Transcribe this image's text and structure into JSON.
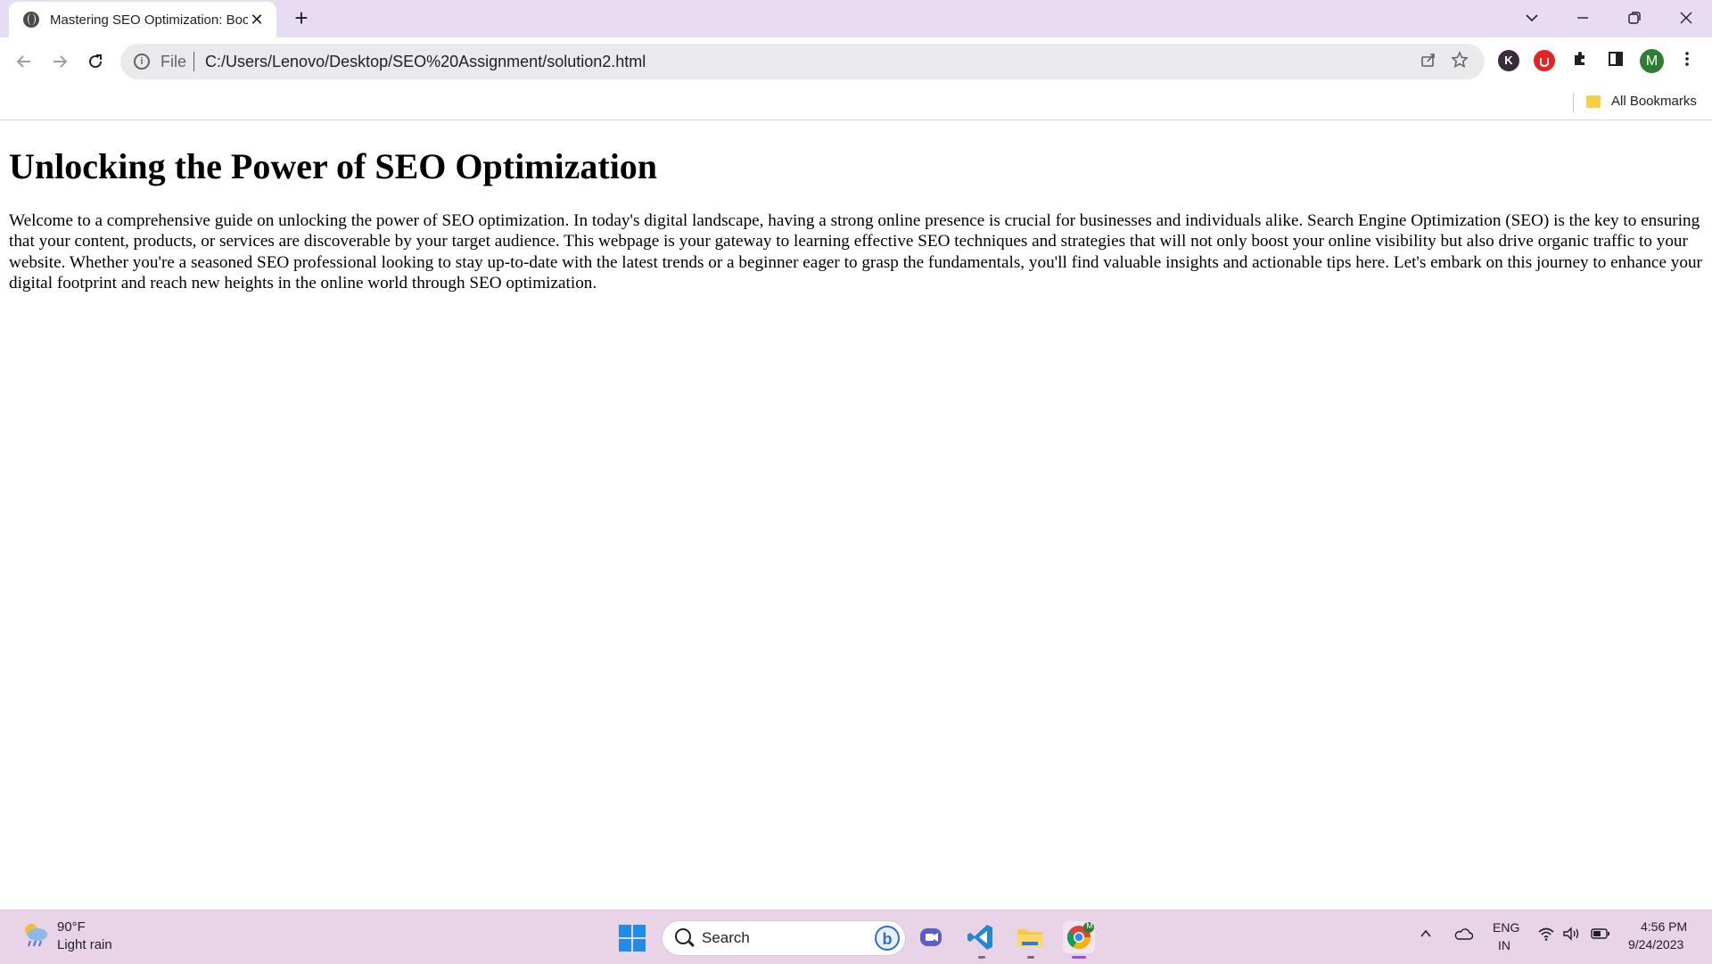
{
  "browser": {
    "tab_title": "Mastering SEO Optimization: Boo",
    "new_tab_glyph": "+",
    "tab_close_glyph": "✕",
    "omnibox": {
      "scheme": "File",
      "url": "C:/Users/Lenovo/Desktop/SEO%20Assignment/solution2.html"
    },
    "profile_initial": "M",
    "extension_k": "K",
    "bookmarks_label": "All Bookmarks"
  },
  "page": {
    "heading": "Unlocking the Power of SEO Optimization",
    "paragraph": "Welcome to a comprehensive guide on unlocking the power of SEO optimization. In today's digital landscape, having a strong online presence is crucial for businesses and individuals alike. Search Engine Optimization (SEO) is the key to ensuring that your content, products, or services are discoverable by your target audience. This webpage is your gateway to learning effective SEO techniques and strategies that will not only boost your online visibility but also drive organic traffic to your website. Whether you're a seasoned SEO professional looking to stay up-to-date with the latest trends or a beginner eager to grasp the fundamentals, you'll find valuable insights and actionable tips here. Let's embark on this journey to enhance your digital footprint and reach new heights in the online world through SEO optimization."
  },
  "taskbar": {
    "weather_temp": "90°F",
    "weather_condition": "Light rain",
    "search_placeholder": "Search",
    "language_line1": "ENG",
    "language_line2": "IN",
    "time": "4:56 PM",
    "date": "9/24/2023",
    "chrome_badge": "M"
  },
  "colors": {
    "tabstrip_bg": "#e8dcf5",
    "taskbar_bg": "#e9d3e6",
    "profile_green": "#2e7d32"
  }
}
